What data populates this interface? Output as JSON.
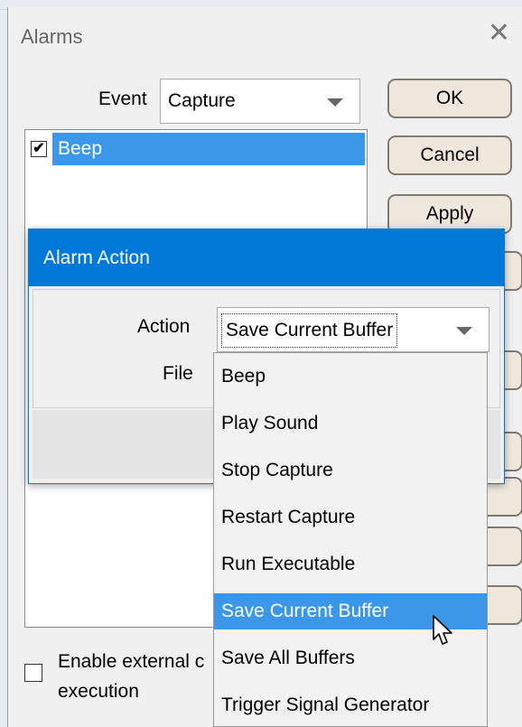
{
  "alarms": {
    "title": "Alarms",
    "close_glyph": "✕",
    "event_label": "Event",
    "event_value": "Capture",
    "list_items": [
      {
        "label": "Beep",
        "checked": true
      }
    ],
    "buttons": {
      "ok": "OK",
      "cancel": "Cancel",
      "apply": "Apply"
    },
    "enable_external_label_line1": "Enable external c",
    "enable_external_label_line2": "execution",
    "check_glyph": "✔"
  },
  "alarm_action": {
    "title": "Alarm Action",
    "action_label": "Action",
    "file_label": "File",
    "action_value": "Save Current Buffer",
    "options": [
      "Beep",
      "Play Sound",
      "Stop Capture",
      "Restart Capture",
      "Run Executable",
      "Save Current Buffer",
      "Save All Buffers",
      "Trigger Signal Generator"
    ],
    "selected_option": "Save Current Buffer"
  },
  "colors": {
    "accent": "#0078d7",
    "selection": "#3c97e8"
  }
}
